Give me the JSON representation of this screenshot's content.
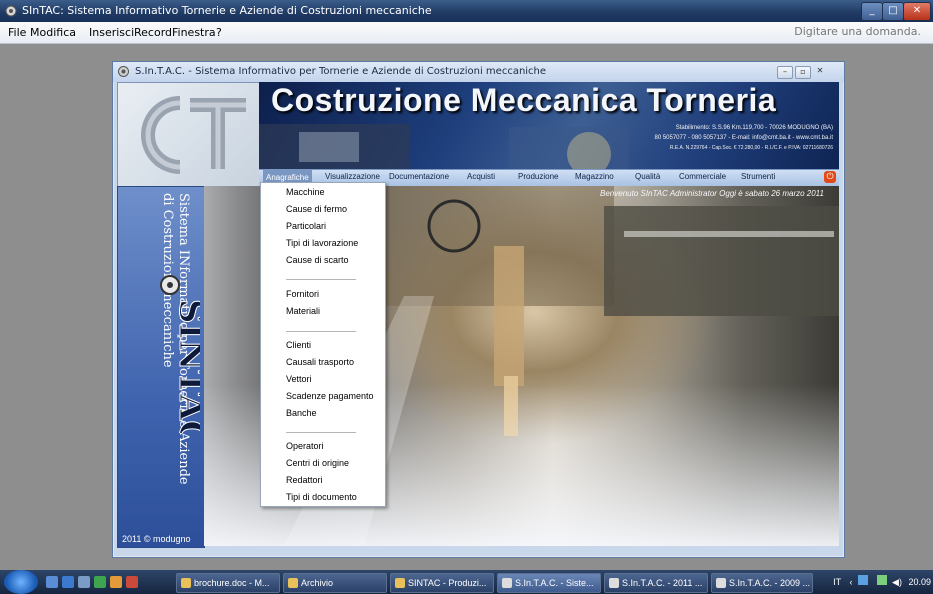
{
  "app_title": "SInTAC: Sistema Informativo Tornerie e Aziende di Costruzioni meccaniche",
  "menubar": {
    "items": [
      "File",
      "Modifica",
      "Inserisci",
      "Record",
      "Finestra",
      "?"
    ],
    "help_placeholder": "Digitare una domanda."
  },
  "child_window": {
    "title": "S.In.T.A.C. - Sistema Informativo per Tornerie e Aziende di Costruzioni meccaniche"
  },
  "banner": {
    "headline": "Costruzione Meccanica Torneria",
    "line1": "Stabilimento: S.S.96 Km.119,700 - 70026 MODUGNO (BA)",
    "line2": "80 5057077 - 080 5057137 - E-mail: info@cmt.ba.it - www.cmt.ba.it",
    "line3": "R.E.A. N.229764 - Cap.Soc. € 72.280,00 - R.I./C.F. e P.IVA: 02711680726"
  },
  "nav": {
    "items": [
      "Anagrafiche",
      "Visualizzazione",
      "Documentazione",
      "Acquisti",
      "Produzione",
      "Magazzino",
      "Qualità",
      "Commerciale",
      "Strumenti"
    ],
    "active": "Anagrafiche"
  },
  "welcome": "Benvenuto SInTAC Administrator Oggi è sabato 26 marzo 2011",
  "side_panel": {
    "vertical_text": "Sistema INformativo per Tornerie e Aziende di Costruzioni meccaniche",
    "logo_text": "SINTAC",
    "copyright": "2011 © modugno"
  },
  "dropdown": {
    "groups": [
      [
        "Macchine",
        "Cause di fermo",
        "Particolari",
        "Tipi di lavorazione",
        "Cause di scarto"
      ],
      [
        "Fornitori",
        "Materiali"
      ],
      [
        "Clienti",
        "Causali trasporto",
        "Vettori",
        "Scadenze pagamento",
        "Banche"
      ],
      [
        "Operatori",
        "Centri di origine",
        "Redattori",
        "Tipi di documento"
      ]
    ]
  },
  "taskbar": {
    "buttons": [
      "brochure.doc - M...",
      "Archivio",
      "SINTAC - Produzi...",
      "S.In.T.A.C. - Siste...",
      "S.In.T.A.C. - 2011 ...",
      "S.In.T.A.C. - 2009 ..."
    ],
    "tray_lang": "IT",
    "clock": "20.09"
  },
  "colors": {
    "banner_navy": "#1e3f7c",
    "nav_blue": "#a9c2e4",
    "panel_blue": "#3f63ae",
    "power_red": "#e24a1a"
  }
}
